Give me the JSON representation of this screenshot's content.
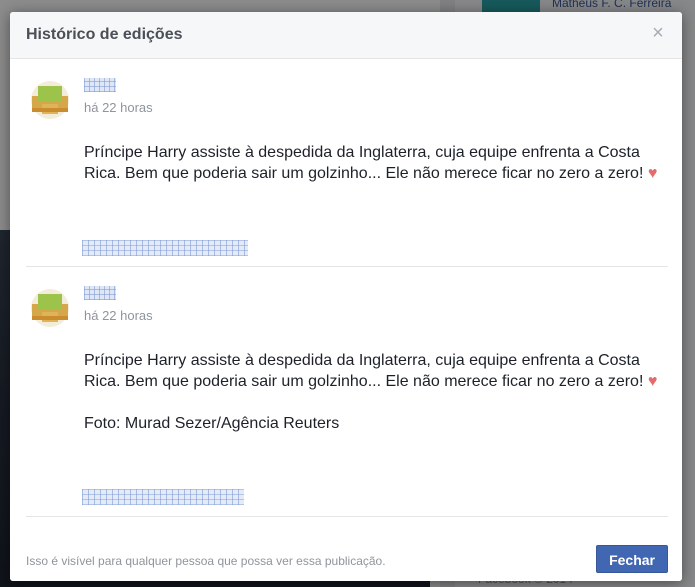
{
  "dialog": {
    "title": "Histórico de edições",
    "close_icon": "close-icon",
    "close_glyph": "×"
  },
  "entries": [
    {
      "timestamp": "há 22 horas",
      "text": "Príncipe Harry assiste à despedida da Inglaterra, cuja equipe enfrenta a Costa Rica. Bem que poderia sair um golzinho... Ele não merece ficar no zero a zero!",
      "emoji": "heart-icon",
      "emoji_glyph": "♥",
      "credit": ""
    },
    {
      "timestamp": "há 22 horas",
      "text": "Príncipe Harry assiste à despedida da Inglaterra, cuja equipe enfrenta a Costa Rica. Bem que poderia sair um golzinho... Ele não merece ficar no zero a zero!",
      "emoji": "heart-icon",
      "emoji_glyph": "♥",
      "credit": "Foto: Murad Sezer/Agência Reuters"
    }
  ],
  "footer": {
    "visibility_note": "Isso é visível para qualquer pessoa que possa ver essa publicação.",
    "close_label": "Fechar"
  },
  "background": {
    "top_name": "Matheus F. C. Ferreira",
    "copyright": "Facebook © 2014"
  },
  "colors": {
    "primary_button": "#4267b2",
    "link": "#3b5998",
    "heart": "#e56b6b"
  }
}
